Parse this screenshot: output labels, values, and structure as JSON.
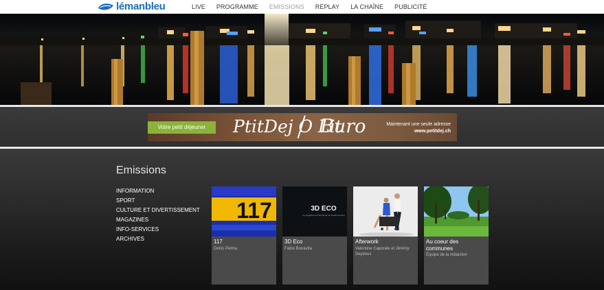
{
  "header": {
    "logo": {
      "part1": "léman",
      "part2": "bleu"
    },
    "nav": [
      {
        "label": "LIVE",
        "active": false
      },
      {
        "label": "PROGRAMME",
        "active": false
      },
      {
        "label": "EMISSIONS",
        "active": true
      },
      {
        "label": "REPLAY",
        "active": false
      },
      {
        "label": "LA CHAÎNE",
        "active": false
      },
      {
        "label": "PUBLICITÉ",
        "active": false
      }
    ]
  },
  "ad": {
    "button_label": "Votre petit déjeuner",
    "brand1": "PtitDej O Lit",
    "brand2": "Buro",
    "tagline": "Maintenant une seule adresse",
    "url": "www.petitdej.ch"
  },
  "main": {
    "title": "Emissions",
    "categories": [
      "INFORMATION",
      "SPORT",
      "CULTURE ET DIVERTISSEMENT",
      "MAGAZINES",
      "INFO-SERVICES",
      "ARCHIVES"
    ],
    "shows": [
      {
        "title": "117",
        "host": "Denis Pelma",
        "thumb_text": "117"
      },
      {
        "title": "3D Eco",
        "host": "Fabio Bonavita",
        "thumb_text": "3D ECO",
        "thumb_sub": "Le magazine de l'économie du Grand Genève"
      },
      {
        "title": "Afterwork",
        "host": "Valentine Caporale et Jérémy Seydoux"
      },
      {
        "title": "Au coeur des communes",
        "host": "Équipe de la rédaction"
      }
    ]
  },
  "colors": {
    "brand_blue": "#1a6fb5",
    "ad_button": "#8bb33a",
    "card_bg": "#4a4a4a",
    "nav_active": "#9c9c9c"
  }
}
